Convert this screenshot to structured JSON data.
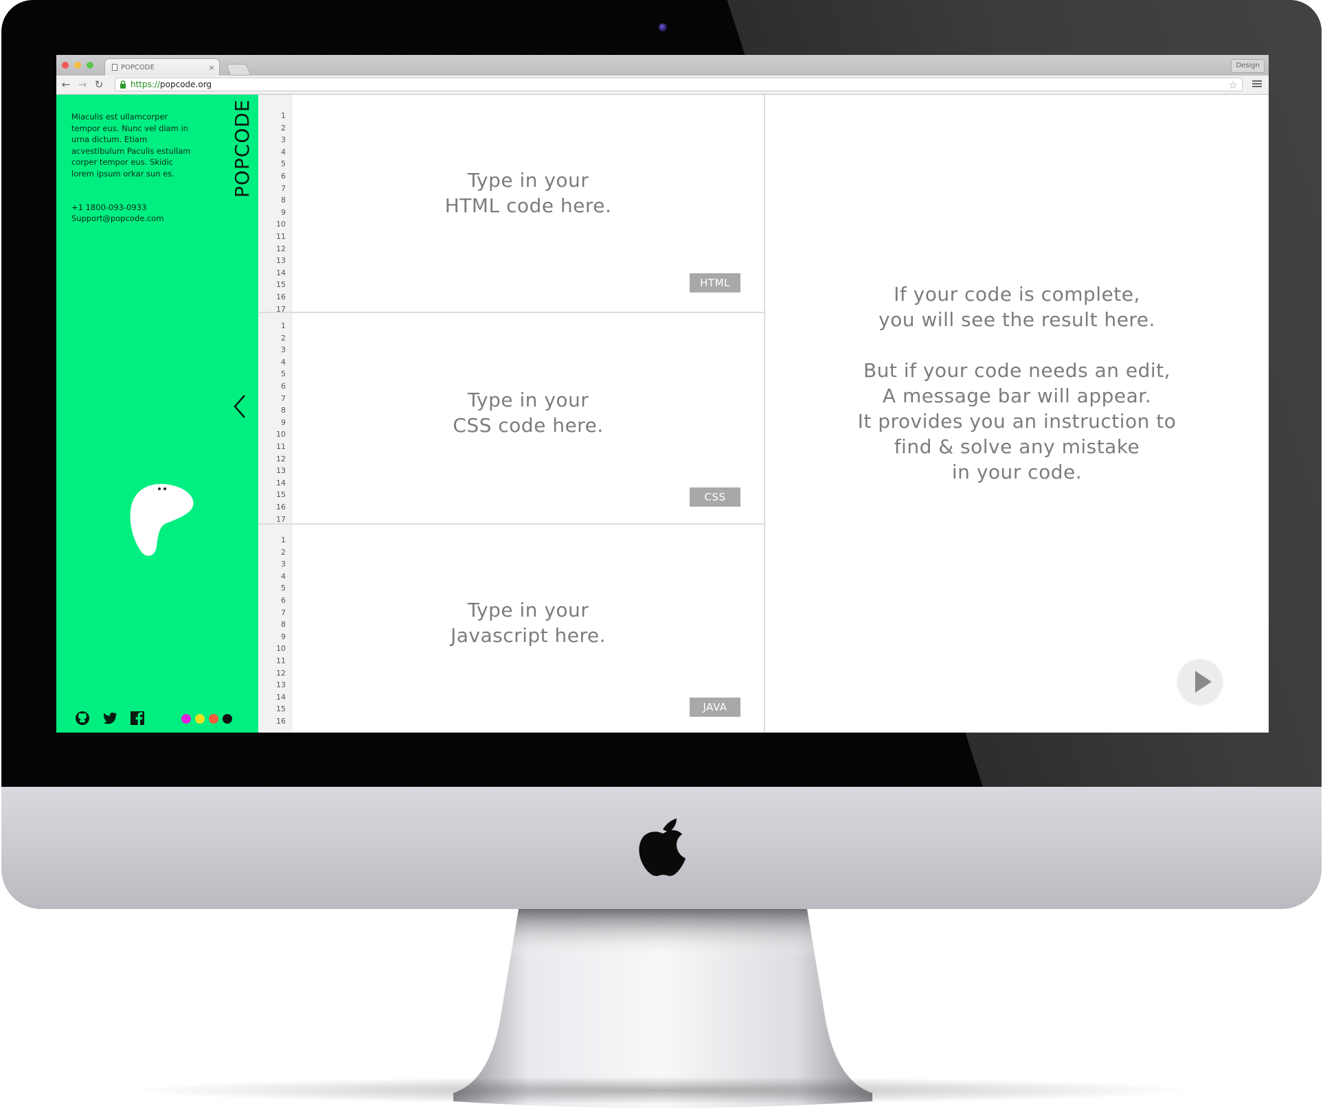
{
  "browser": {
    "tab_title": "POPCODE",
    "tab_close": "×",
    "profile_label": "Design",
    "url_scheme": "https://",
    "url_host": "popcode.org"
  },
  "sidebar": {
    "description": "Miaculis est ullamcorper tempor eus. Nunc vel diam in urna dictum. Etiam acvestibulum Paculis estullam corper tempor eus. Skidic lorem ipsum orkar sun es.",
    "phone": "+1 1800-093-0933",
    "email": "Support@popcode.com",
    "brand": "POPCODE",
    "accent_color": "#00ef80",
    "socials": [
      "github-icon",
      "twitter-icon",
      "facebook-icon"
    ],
    "theme_colors": [
      "#e020e0",
      "#f0e020",
      "#ff5a3c",
      "#111111"
    ]
  },
  "editors": [
    {
      "placeholder_line1": "Type in your",
      "placeholder_line2": "HTML code here.",
      "badge": "HTML",
      "lines": "1\n2\n3\n4\n5\n6\n7\n8\n9\n10\n11\n12\n13\n14\n15\n16\n17"
    },
    {
      "placeholder_line1": "Type in your",
      "placeholder_line2": "CSS code here.",
      "badge": "CSS",
      "lines": "1\n2\n3\n4\n5\n6\n7\n8\n9\n10\n11\n12\n13\n14\n15\n16\n17"
    },
    {
      "placeholder_line1": "Type in your",
      "placeholder_line2": "Javascript here.",
      "badge": "JAVA",
      "lines": "1\n2\n3\n4\n5\n6\n7\n8\n9\n10\n11\n12\n13\n14\n15\n16"
    }
  ],
  "preview": {
    "line1": "If your code is complete,",
    "line2": "you will see the result here.",
    "line3": "But if your code needs an edit,",
    "line4": "A message bar will appear.",
    "line5": "It provides you an instruction to",
    "line6": "find & solve any mistake",
    "line7": "in your code."
  }
}
